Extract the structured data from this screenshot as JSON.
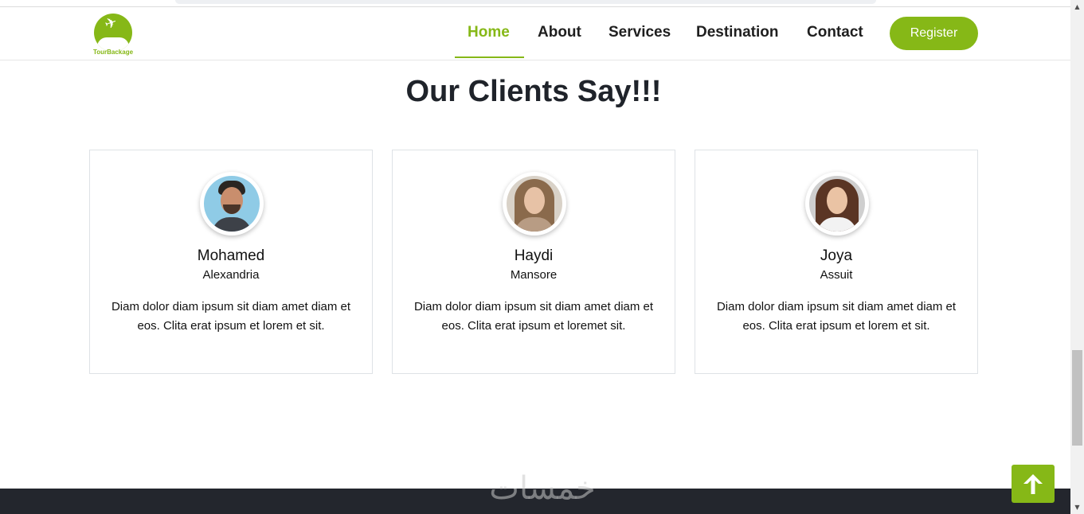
{
  "brand": {
    "name": "TourBackage",
    "accent_color": "#86b817",
    "logo_icon": "airplane-icon"
  },
  "nav": {
    "items": [
      {
        "label": "Home",
        "active": true
      },
      {
        "label": "About",
        "active": false
      },
      {
        "label": "Services",
        "active": false
      },
      {
        "label": "Destination",
        "active": false
      },
      {
        "label": "Contact",
        "active": false
      }
    ],
    "register_label": "Register"
  },
  "testimonials": {
    "title": "Our Clients Say!!!",
    "clients": [
      {
        "name": "Mohamed",
        "city": "Alexandria",
        "quote": "Diam dolor diam ipsum sit diam amet diam et eos. Clita erat ipsum et lorem et sit."
      },
      {
        "name": "Haydi",
        "city": "Mansore",
        "quote": "Diam dolor diam ipsum sit diam amet diam et eos. Clita erat ipsum et loremet sit."
      },
      {
        "name": "Joya",
        "city": "Assuit",
        "quote": "Diam dolor diam ipsum sit diam amet diam et eos. Clita erat ipsum et lorem et sit."
      }
    ]
  },
  "watermark": {
    "text": "خمسات"
  },
  "back_to_top": {
    "icon": "arrow-up-icon"
  },
  "footer": {
    "color": "#23262d"
  }
}
